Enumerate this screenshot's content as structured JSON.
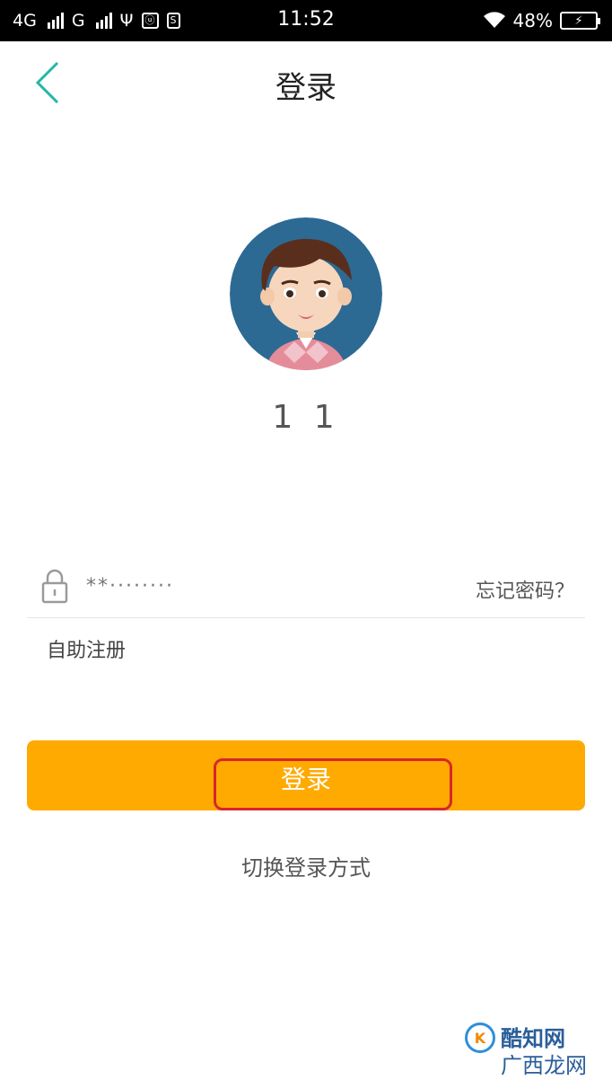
{
  "status_bar": {
    "network_1": "4G",
    "network_2": "G",
    "sim_icon_text": "S",
    "time": "11:52",
    "battery": "48%",
    "icons": [
      "signal-icon",
      "usb-icon",
      "wifi-icon",
      "battery-icon"
    ]
  },
  "header": {
    "title": "登录",
    "back_icon": "chevron-left-icon"
  },
  "account": {
    "avatar": "user-avatar",
    "number": "1      1"
  },
  "password": {
    "value": "**········",
    "icon": "lock-icon",
    "forgot_label": "忘记密码？"
  },
  "register_label": "自助注册",
  "login_button": {
    "label": "登录"
  },
  "switch_label": "切换登录方式",
  "watermark": {
    "text": "酷知网",
    "sub": "广西龙网"
  },
  "colors": {
    "accent": "#ffaa00",
    "back_arrow": "#23b7a6",
    "highlight": "#d9262b"
  }
}
